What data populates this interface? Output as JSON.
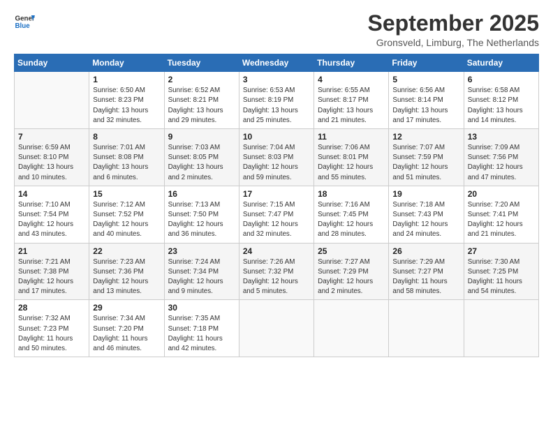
{
  "logo": {
    "line1": "General",
    "line2": "Blue"
  },
  "title": "September 2025",
  "subtitle": "Gronsveld, Limburg, The Netherlands",
  "headers": [
    "Sunday",
    "Monday",
    "Tuesday",
    "Wednesday",
    "Thursday",
    "Friday",
    "Saturday"
  ],
  "weeks": [
    [
      {
        "day": "",
        "info": ""
      },
      {
        "day": "1",
        "info": "Sunrise: 6:50 AM\nSunset: 8:23 PM\nDaylight: 13 hours\nand 32 minutes."
      },
      {
        "day": "2",
        "info": "Sunrise: 6:52 AM\nSunset: 8:21 PM\nDaylight: 13 hours\nand 29 minutes."
      },
      {
        "day": "3",
        "info": "Sunrise: 6:53 AM\nSunset: 8:19 PM\nDaylight: 13 hours\nand 25 minutes."
      },
      {
        "day": "4",
        "info": "Sunrise: 6:55 AM\nSunset: 8:17 PM\nDaylight: 13 hours\nand 21 minutes."
      },
      {
        "day": "5",
        "info": "Sunrise: 6:56 AM\nSunset: 8:14 PM\nDaylight: 13 hours\nand 17 minutes."
      },
      {
        "day": "6",
        "info": "Sunrise: 6:58 AM\nSunset: 8:12 PM\nDaylight: 13 hours\nand 14 minutes."
      }
    ],
    [
      {
        "day": "7",
        "info": "Sunrise: 6:59 AM\nSunset: 8:10 PM\nDaylight: 13 hours\nand 10 minutes."
      },
      {
        "day": "8",
        "info": "Sunrise: 7:01 AM\nSunset: 8:08 PM\nDaylight: 13 hours\nand 6 minutes."
      },
      {
        "day": "9",
        "info": "Sunrise: 7:03 AM\nSunset: 8:05 PM\nDaylight: 13 hours\nand 2 minutes."
      },
      {
        "day": "10",
        "info": "Sunrise: 7:04 AM\nSunset: 8:03 PM\nDaylight: 12 hours\nand 59 minutes."
      },
      {
        "day": "11",
        "info": "Sunrise: 7:06 AM\nSunset: 8:01 PM\nDaylight: 12 hours\nand 55 minutes."
      },
      {
        "day": "12",
        "info": "Sunrise: 7:07 AM\nSunset: 7:59 PM\nDaylight: 12 hours\nand 51 minutes."
      },
      {
        "day": "13",
        "info": "Sunrise: 7:09 AM\nSunset: 7:56 PM\nDaylight: 12 hours\nand 47 minutes."
      }
    ],
    [
      {
        "day": "14",
        "info": "Sunrise: 7:10 AM\nSunset: 7:54 PM\nDaylight: 12 hours\nand 43 minutes."
      },
      {
        "day": "15",
        "info": "Sunrise: 7:12 AM\nSunset: 7:52 PM\nDaylight: 12 hours\nand 40 minutes."
      },
      {
        "day": "16",
        "info": "Sunrise: 7:13 AM\nSunset: 7:50 PM\nDaylight: 12 hours\nand 36 minutes."
      },
      {
        "day": "17",
        "info": "Sunrise: 7:15 AM\nSunset: 7:47 PM\nDaylight: 12 hours\nand 32 minutes."
      },
      {
        "day": "18",
        "info": "Sunrise: 7:16 AM\nSunset: 7:45 PM\nDaylight: 12 hours\nand 28 minutes."
      },
      {
        "day": "19",
        "info": "Sunrise: 7:18 AM\nSunset: 7:43 PM\nDaylight: 12 hours\nand 24 minutes."
      },
      {
        "day": "20",
        "info": "Sunrise: 7:20 AM\nSunset: 7:41 PM\nDaylight: 12 hours\nand 21 minutes."
      }
    ],
    [
      {
        "day": "21",
        "info": "Sunrise: 7:21 AM\nSunset: 7:38 PM\nDaylight: 12 hours\nand 17 minutes."
      },
      {
        "day": "22",
        "info": "Sunrise: 7:23 AM\nSunset: 7:36 PM\nDaylight: 12 hours\nand 13 minutes."
      },
      {
        "day": "23",
        "info": "Sunrise: 7:24 AM\nSunset: 7:34 PM\nDaylight: 12 hours\nand 9 minutes."
      },
      {
        "day": "24",
        "info": "Sunrise: 7:26 AM\nSunset: 7:32 PM\nDaylight: 12 hours\nand 5 minutes."
      },
      {
        "day": "25",
        "info": "Sunrise: 7:27 AM\nSunset: 7:29 PM\nDaylight: 12 hours\nand 2 minutes."
      },
      {
        "day": "26",
        "info": "Sunrise: 7:29 AM\nSunset: 7:27 PM\nDaylight: 11 hours\nand 58 minutes."
      },
      {
        "day": "27",
        "info": "Sunrise: 7:30 AM\nSunset: 7:25 PM\nDaylight: 11 hours\nand 54 minutes."
      }
    ],
    [
      {
        "day": "28",
        "info": "Sunrise: 7:32 AM\nSunset: 7:23 PM\nDaylight: 11 hours\nand 50 minutes."
      },
      {
        "day": "29",
        "info": "Sunrise: 7:34 AM\nSunset: 7:20 PM\nDaylight: 11 hours\nand 46 minutes."
      },
      {
        "day": "30",
        "info": "Sunrise: 7:35 AM\nSunset: 7:18 PM\nDaylight: 11 hours\nand 42 minutes."
      },
      {
        "day": "",
        "info": ""
      },
      {
        "day": "",
        "info": ""
      },
      {
        "day": "",
        "info": ""
      },
      {
        "day": "",
        "info": ""
      }
    ]
  ]
}
